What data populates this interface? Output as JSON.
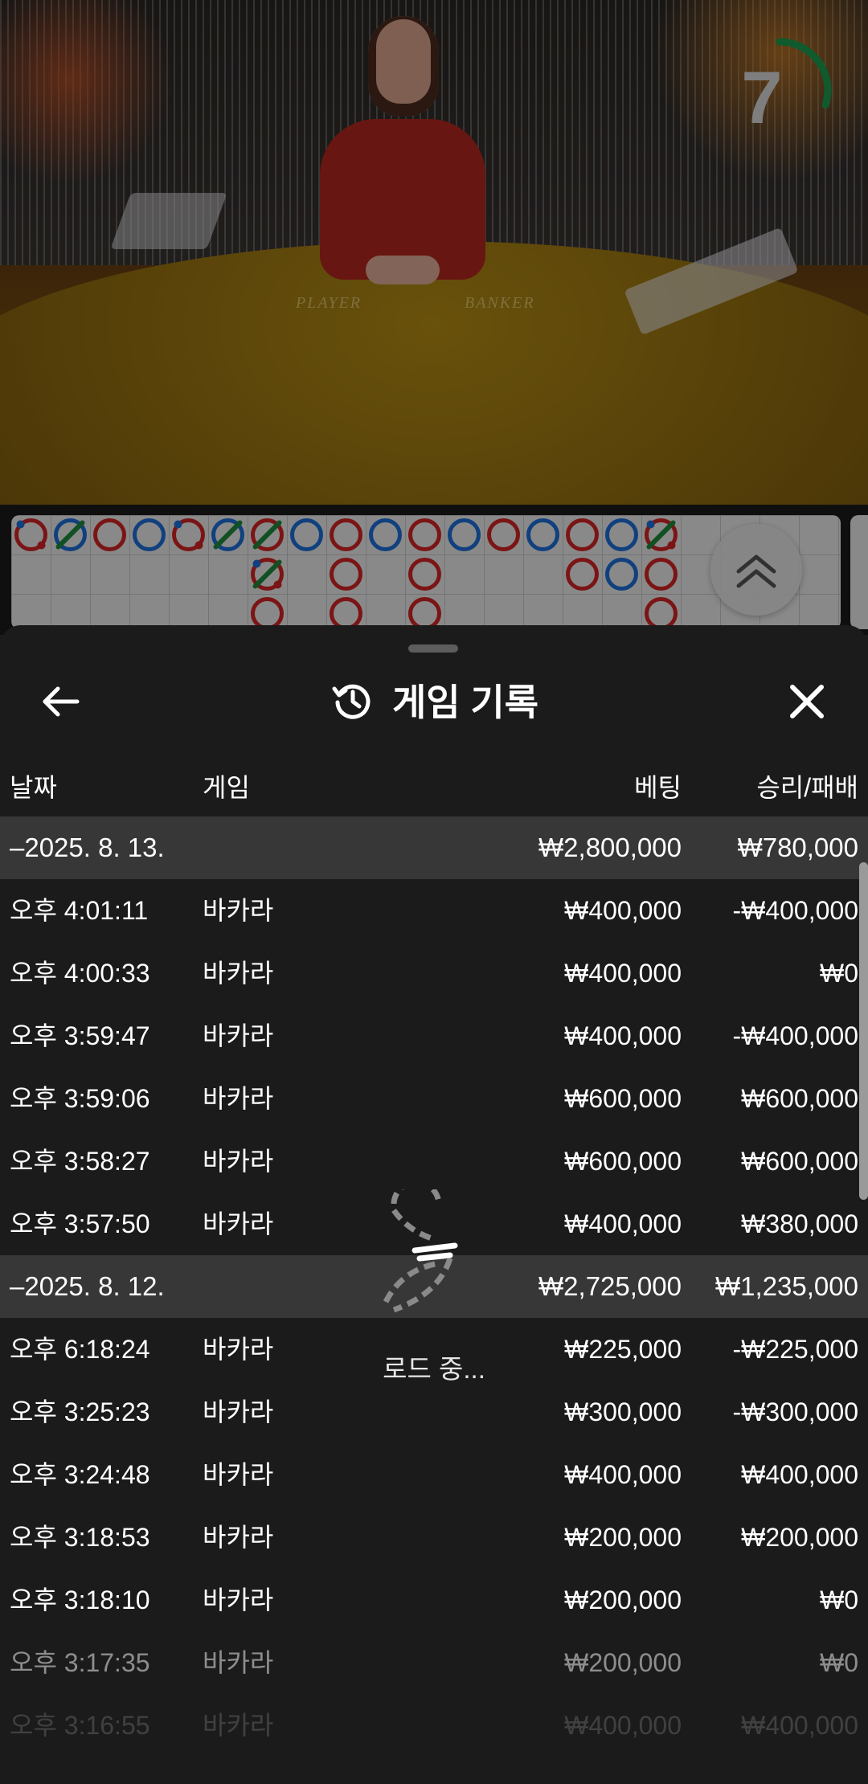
{
  "video": {
    "table_label_player": "PLAYER",
    "table_label_banker": "BANKER",
    "timer_value": "7",
    "timer_progress": 0.3,
    "timer_color": "#1e9b4f"
  },
  "roadmap": {
    "colors": {
      "player": "#1e6fd9",
      "banker": "#d42525",
      "tie": "#1e8a3c"
    },
    "columns": [
      [
        "banker-pair"
      ],
      [
        "player-tie"
      ],
      [
        "banker"
      ],
      [
        "player"
      ],
      [
        "banker-pair"
      ],
      [
        "player-tie"
      ],
      [
        "banker-tie",
        "banker-tie-pair",
        "banker"
      ],
      [
        "player"
      ],
      [
        "banker",
        "banker",
        "banker"
      ],
      [
        "player"
      ],
      [
        "banker",
        "banker",
        "banker"
      ],
      [
        "player"
      ],
      [
        "banker"
      ],
      [
        "player"
      ],
      [
        "banker",
        "banker"
      ],
      [
        "player",
        "player"
      ],
      [
        "banker-tie-pair",
        "banker",
        "banker"
      ]
    ]
  },
  "sheet": {
    "title": "게임 기록",
    "columns": {
      "date": "날짜",
      "game": "게임",
      "bet": "베팅",
      "winloss": "승리/패배"
    },
    "groups": [
      {
        "date": "–2025. 8. 13.",
        "bet": "₩2,800,000",
        "winloss": "₩780,000",
        "rows": [
          {
            "time": "오후 4:01:11",
            "game": "바카라",
            "bet": "₩400,000",
            "winloss": "-₩400,000"
          },
          {
            "time": "오후 4:00:33",
            "game": "바카라",
            "bet": "₩400,000",
            "winloss": "₩0"
          },
          {
            "time": "오후 3:59:47",
            "game": "바카라",
            "bet": "₩400,000",
            "winloss": "-₩400,000"
          },
          {
            "time": "오후 3:59:06",
            "game": "바카라",
            "bet": "₩600,000",
            "winloss": "₩600,000"
          },
          {
            "time": "오후 3:58:27",
            "game": "바카라",
            "bet": "₩600,000",
            "winloss": "₩600,000"
          },
          {
            "time": "오후 3:57:50",
            "game": "바카라",
            "bet": "₩400,000",
            "winloss": "₩380,000"
          }
        ]
      },
      {
        "date": "–2025. 8. 12.",
        "bet": "₩2,725,000",
        "winloss": "₩1,235,000",
        "rows": [
          {
            "time": "오후 6:18:24",
            "game": "바카라",
            "bet": "₩225,000",
            "winloss": "-₩225,000"
          },
          {
            "time": "오후 3:25:23",
            "game": "바카라",
            "bet": "₩300,000",
            "winloss": "-₩300,000"
          },
          {
            "time": "오후 3:24:48",
            "game": "바카라",
            "bet": "₩400,000",
            "winloss": "₩400,000"
          },
          {
            "time": "오후 3:18:53",
            "game": "바카라",
            "bet": "₩200,000",
            "winloss": "₩200,000"
          },
          {
            "time": "오후 3:18:10",
            "game": "바카라",
            "bet": "₩200,000",
            "winloss": "₩0"
          },
          {
            "time": "오후 3:17:35",
            "game": "바카라",
            "bet": "₩200,000",
            "winloss": "₩0"
          },
          {
            "time": "오후 3:16:55",
            "game": "바카라",
            "bet": "₩400,000",
            "winloss": "₩400,000"
          }
        ]
      }
    ],
    "loading_text": "로드 중..."
  }
}
